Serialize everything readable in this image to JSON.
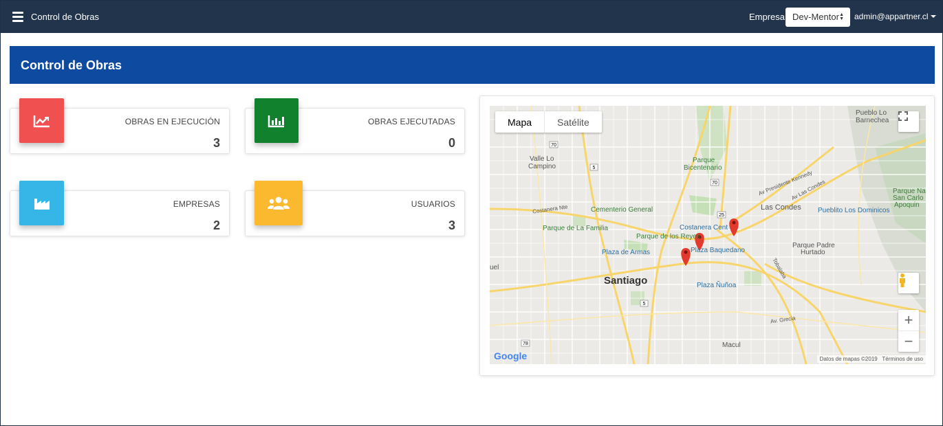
{
  "navbar": {
    "title": "Control de Obras",
    "empresa_label": "Empresa",
    "empresa_selected": "Dev-Mentor",
    "user": "admin@appartner.cl"
  },
  "header": {
    "title": "Control de Obras"
  },
  "cards": [
    {
      "label": "OBRAS EN EJECUCIÓN",
      "value": "3",
      "icon": "line-chart-icon",
      "color": "#f05050"
    },
    {
      "label": "OBRAS EJECUTADAS",
      "value": "0",
      "icon": "bar-chart-icon",
      "color": "#11812e"
    },
    {
      "label": "EMPRESAS",
      "value": "2",
      "icon": "factory-icon",
      "color": "#35b6e7"
    },
    {
      "label": "USUARIOS",
      "value": "3",
      "icon": "users-icon",
      "color": "#fbb930"
    }
  ],
  "map": {
    "type_buttons": [
      "Mapa",
      "Satélite"
    ],
    "active_type": "Mapa",
    "attribution": "Datos de mapas ©2019",
    "terms": "Términos de uso",
    "labels": {
      "pueblo": "Pueblo Lo",
      "barnechea": "Barnechea",
      "valle": "Valle Lo",
      "campino": "Campino",
      "parque_bicentenario_1": "Parque",
      "parque_bicentenario_2": "Bicentenario",
      "kennedy": "Av Presidente Kennedy",
      "las_condes_av": "Av Las Condes",
      "las_condes": "Las Condes",
      "pueblito": "Pueblito Los Dominicos",
      "parque_na_1": "Parque Na",
      "parque_na_2": "San Carlo",
      "parque_na_3": "Apoquin",
      "costanera_norte": "Costanera Nte",
      "cementerio": "Cementerio General",
      "parque_familia": "Parque de La Familia",
      "costanera_center": "Costanera Cent",
      "parque_reyes": "Parque de los Reyes",
      "plaza_baquedano": "Plaza Baquedano",
      "plaza_armas": "Plaza de Armas",
      "parque_padre_1": "Parque Padre",
      "parque_padre_2": "Hurtado",
      "tobalaba": "Tobalaba",
      "santiago": "Santiago",
      "plaza_nunoa": "Plaza Ñuñoa",
      "av_grecia": "Av. Grecia",
      "macul": "Macul",
      "uel": "uel",
      "google": "Google",
      "r70a": "70",
      "r5a": "5",
      "r70b": "70",
      "r5b": "5",
      "r78": "78",
      "r25": "25"
    }
  }
}
